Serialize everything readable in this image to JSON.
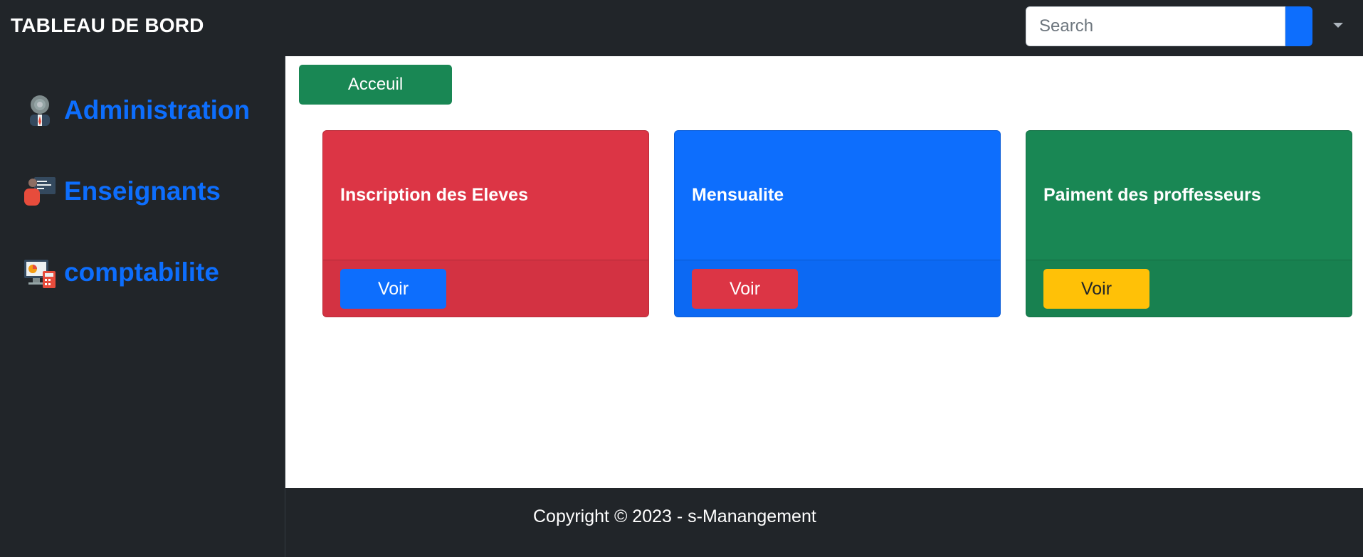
{
  "header": {
    "brand": "TABLEAU DE BORD",
    "search_placeholder": "Search"
  },
  "sidebar": {
    "items": [
      {
        "label": "Administration",
        "icon": "admin-gear-person-icon"
      },
      {
        "label": "Enseignants",
        "icon": "teacher-board-icon"
      },
      {
        "label": "comptabilite",
        "icon": "accounting-monitor-calculator-icon"
      }
    ]
  },
  "main": {
    "home_button": "Acceuil",
    "cards": [
      {
        "title": "Inscription des Eleves",
        "button": "Voir",
        "color": "#dc3545",
        "button_color": "#0d6efd"
      },
      {
        "title": "Mensualite",
        "button": "Voir",
        "color": "#0d6efd",
        "button_color": "#dc3545"
      },
      {
        "title": "Paiment des proffesseurs",
        "button": "Voir",
        "color": "#198754",
        "button_color": "#ffc107"
      }
    ]
  },
  "footer": {
    "text": "Copyright © 2023 - s-Manangement"
  }
}
